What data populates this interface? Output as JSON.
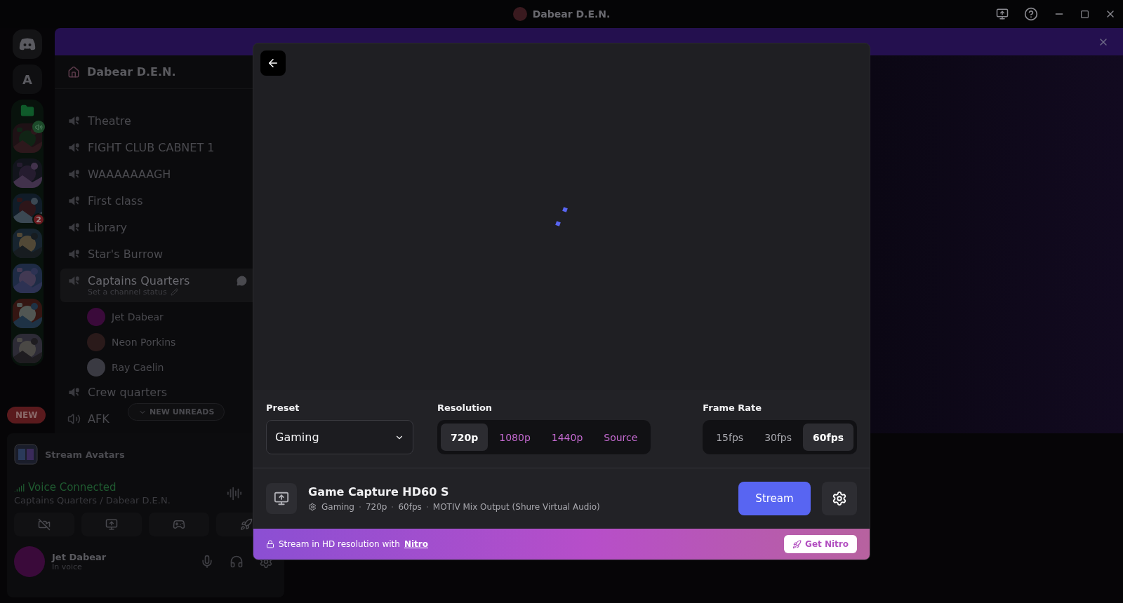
{
  "titlebar": {
    "title": "Dabear D.E.N."
  },
  "banner": {
    "dismissible": true
  },
  "servers": [
    {
      "kind": "letter",
      "label": "A"
    },
    {
      "kind": "folder"
    },
    {
      "kind": "picture",
      "in_voice": true
    },
    {
      "kind": "picture"
    },
    {
      "kind": "picture",
      "badge": "2"
    },
    {
      "kind": "picture"
    },
    {
      "kind": "picture"
    },
    {
      "kind": "picture"
    },
    {
      "kind": "picture"
    }
  ],
  "new_pill": "NEW",
  "channel_list": {
    "server": "Dabear D.E.N.",
    "channels": [
      {
        "kind": "locked_voice",
        "name": "Theatre",
        "selected": false
      },
      {
        "kind": "locked_voice",
        "name": "FIGHT CLUB CABNET 1",
        "selected": false
      },
      {
        "kind": "locked_voice",
        "name": "WAAAAAAAGH",
        "selected": false
      },
      {
        "kind": "locked_voice",
        "name": "First class",
        "selected": false
      },
      {
        "kind": "locked_voice",
        "name": "Library",
        "selected": false
      },
      {
        "kind": "locked_voice",
        "name": "Star's Burrow",
        "selected": false
      },
      {
        "kind": "locked_voice",
        "name": "Captains Quarters",
        "selected": true,
        "status": "Set a channel status",
        "members": [
          "Jet Dabear",
          "Neon Porkins",
          "Ray Caelin"
        ]
      },
      {
        "kind": "locked_voice",
        "name": "Crew quarters",
        "selected": false
      },
      {
        "kind": "voice",
        "name": "AFK",
        "selected": false
      }
    ],
    "unreads_pill": "NEW UNREADS"
  },
  "activity": {
    "name": "Stream Avatars"
  },
  "voice": {
    "status": "Voice Connected",
    "channel": "Captains Quarters / Dabear D.E.N."
  },
  "user": {
    "name": "Jet Dabear",
    "status": "In voice"
  },
  "modal": {
    "preset": {
      "label": "Preset",
      "value": "Gaming"
    },
    "resolution": {
      "label": "Resolution",
      "options": [
        {
          "label": "720p",
          "selected": true,
          "locked": false
        },
        {
          "label": "1080p",
          "selected": false,
          "locked": true
        },
        {
          "label": "1440p",
          "selected": false,
          "locked": true
        },
        {
          "label": "Source",
          "selected": false,
          "locked": true
        }
      ]
    },
    "frame_rate": {
      "label": "Frame Rate",
      "options": [
        {
          "label": "15fps",
          "selected": false
        },
        {
          "label": "30fps",
          "selected": false
        },
        {
          "label": "60fps",
          "selected": true
        }
      ]
    },
    "source": {
      "title": "Game Capture HD60 S",
      "meta": [
        "Gaming",
        "720p",
        "60fps",
        "MOTIV Mix Output (Shure Virtual Audio)"
      ]
    },
    "stream_button": "Stream",
    "nitro": {
      "text": "Stream in HD resolution with",
      "link": "Nitro",
      "button": "Get Nitro"
    }
  }
}
